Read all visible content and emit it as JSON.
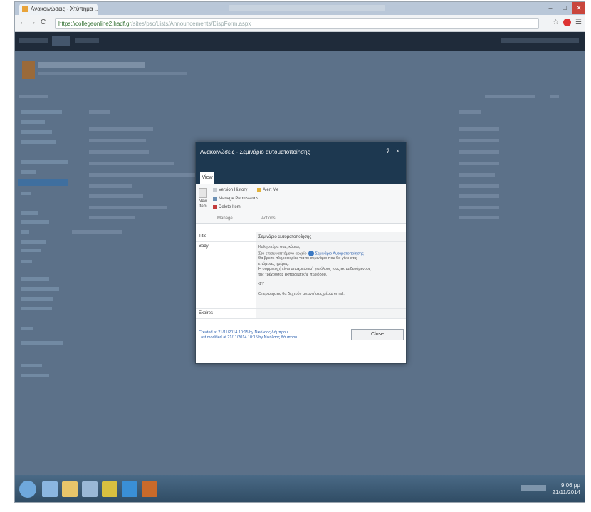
{
  "browser": {
    "tab_title": "Ανακοινώσεις - Χτύπημα ...",
    "url_host": "https://collegeonline2.hadf.gr",
    "url_rest": "/sites/psc/Lists/Announcements/DispForm.aspx",
    "window_controls": [
      "–",
      "□",
      "✕"
    ],
    "nav": [
      "←",
      "→",
      "C"
    ],
    "toolbar_icons": [
      "☆",
      "☰"
    ]
  },
  "dialog": {
    "title": "Ανακοινώσεις - Σεμινάριο αυτοματοποίησης",
    "controls": "? ×",
    "tab": "View",
    "ribbon": {
      "new_item_label": "New Item",
      "items": [
        "Version History",
        "Manage Permissions",
        "Delete Item",
        "Alert Me"
      ],
      "group_manage": "Manage",
      "group_actions": "Actions"
    },
    "fields": [
      {
        "label": "Title",
        "value": "Σεμινάριο αυτοματοποίησης"
      },
      {
        "label": "Body",
        "value": ""
      },
      {
        "label": "Expires",
        "value": ""
      }
    ],
    "body_lines": [
      "Καλησπέρα σας, κύριοι,",
      "Στο επισυναπτόμενο αρχείο",
      "θα βρείτε πληροφορίες για το σεμινάριο που θα γίνει στις",
      "επόμενες ημέρες.",
      "Η συμμετοχή είναι υποχρεωτική για όλους τους εκπαιδευόμενους",
      "της τρέχουσας εκπαιδευτικής περιόδου.",
      "ΦΥ",
      "Οι ερωτήσεις θα δεχτούν απαντήσεις μέσω email."
    ],
    "attachment": "Σεμινάριο Αυτοματοποίησης",
    "footer_created": "Created at 21/11/2014 10:15 by Νικόλαος Λάμπρου",
    "footer_modified": "Last modified at 21/11/2014 10:15 by Νικόλαος Λάμπρου",
    "close_label": "Close"
  },
  "taskbar": {
    "time": "9:06 μμ",
    "date": "21/11/2014"
  },
  "colors": {
    "dialog_header": "#1d3850",
    "page_dim": "#5c7189",
    "link": "#2a5fae"
  }
}
